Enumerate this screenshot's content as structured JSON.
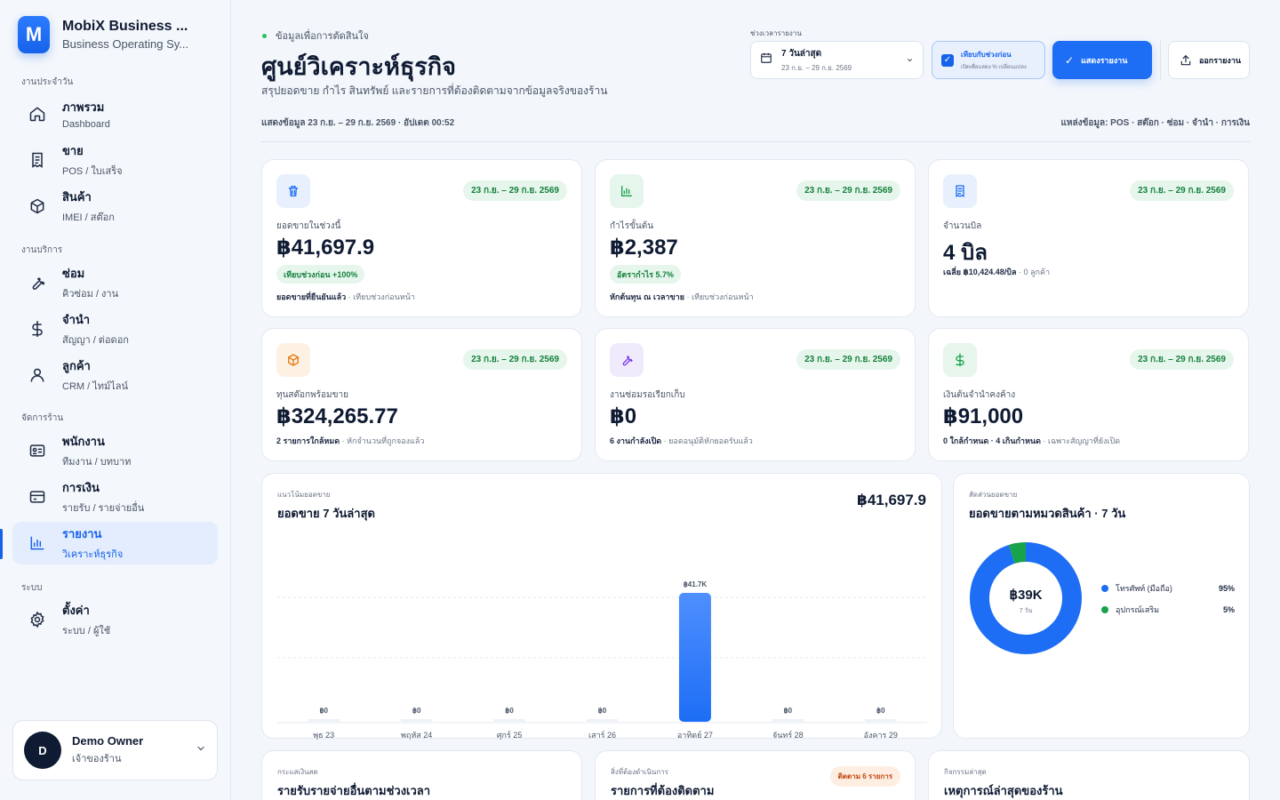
{
  "brand": {
    "logo_letter": "M",
    "title": "MobiX Business ...",
    "subtitle": "Business Operating Sy..."
  },
  "sidebar": {
    "sections": [
      "งานประจำวัน",
      "งานบริการ",
      "จัดการร้าน",
      "ระบบ"
    ],
    "items": [
      {
        "title": "ภาพรวม",
        "sub": "Dashboard",
        "icon": "home-icon"
      },
      {
        "title": "ขาย",
        "sub": "POS / ใบเสร็จ",
        "icon": "receipt-icon"
      },
      {
        "title": "สินค้า",
        "sub": "IMEI / สต๊อก",
        "icon": "box-icon"
      },
      {
        "title": "ซ่อม",
        "sub": "คิวซ่อม / งาน",
        "icon": "wrench-icon"
      },
      {
        "title": "จำนำ",
        "sub": "สัญญา / ต่อดอก",
        "icon": "dollar-icon"
      },
      {
        "title": "ลูกค้า",
        "sub": "CRM / ไทม์ไลน์",
        "icon": "user-icon"
      },
      {
        "title": "พนักงาน",
        "sub": "ทีมงาน / บทบาท",
        "icon": "id-card-icon"
      },
      {
        "title": "การเงิน",
        "sub": "รายรับ / รายจ่ายอื่น",
        "icon": "card-icon"
      },
      {
        "title": "รายงาน",
        "sub": "วิเคราะห์ธุรกิจ",
        "icon": "bar-chart-icon"
      },
      {
        "title": "ตั้งค่า",
        "sub": "ระบบ / ผู้ใช้",
        "icon": "gear-icon"
      }
    ]
  },
  "user": {
    "initial": "D",
    "name": "Demo Owner",
    "role": "เจ้าของร้าน"
  },
  "header": {
    "eyebrow": "ข้อมูลเพื่อการตัดสินใจ",
    "title": "ศูนย์วิเคราะห์ธุรกิจ",
    "description": "สรุปยอดขาย กำไร สินทรัพย์ และรายการที่ต้องติดตามจากข้อมูลจริงของร้าน",
    "range_label": "ช่วงเวลารายงาน",
    "range_main": "7 วันล่าสุด",
    "range_sub": "23 ก.ย. – 29 ก.ย. 2569",
    "compare_main": "เทียบกับช่วงก่อน",
    "compare_sub": "เปิดเพื่อแสดง % เปลี่ยนแปลง",
    "show_button": "แสดงรายงาน",
    "export_button": "ออกรายงาน",
    "info_left": "แสดงข้อมูล 23 ก.ย. – 29 ก.ย. 2569 · อัปเดต 00:52",
    "info_right": "แหล่งข้อมูล: POS · สต๊อก · ซ่อม · จำนำ · การเงิน"
  },
  "stats": [
    {
      "label": "ยอดขายในช่วงนี้",
      "value": "฿41,697.9",
      "pill": "เทียบช่วงก่อน +100%",
      "foot_bold": "ยอดขายที่ยืนยันแล้ว",
      "foot": " · เทียบช่วงก่อนหน้า",
      "date": "23 ก.ย. – 29 ก.ย. 2569",
      "icon": "trash-icon",
      "icon_color": "#1d6ef5",
      "icon_bg": "#e8f0fd"
    },
    {
      "label": "กำไรขั้นต้น",
      "value": "฿2,387",
      "pill": "อัตรากำไร 5.7%",
      "foot_bold": "หักต้นทุน ณ เวลาขาย",
      "foot": " · เทียบช่วงก่อนหน้า",
      "date": "23 ก.ย. – 29 ก.ย. 2569",
      "icon": "bar-chart-icon",
      "icon_color": "#16a34a",
      "icon_bg": "#e6f6ec"
    },
    {
      "label": "จำนวนบิล",
      "value": "4 บิล",
      "foot_bold": "เฉลี่ย ฿10,424.48/บิล",
      "foot": " · 0 ลูกค้า",
      "date": "23 ก.ย. – 29 ก.ย. 2569",
      "icon": "receipt-icon",
      "icon_color": "#1d6ef5",
      "icon_bg": "#e8f0fd"
    },
    {
      "label": "ทุนสต๊อกพร้อมขาย",
      "value": "฿324,265.77",
      "foot_bold": "2 รายการใกล้หมด",
      "foot": " · หักจำนวนที่ถูกจองแล้ว",
      "date": "23 ก.ย. – 29 ก.ย. 2569",
      "icon": "box-icon",
      "icon_color": "#ea7a12",
      "icon_bg": "#fdf1e3"
    },
    {
      "label": "งานซ่อมรอเรียกเก็บ",
      "value": "฿0",
      "foot_bold": "6 งานกำลังเปิด",
      "foot": " · ยอดอนุมัติหักยอดรับแล้ว",
      "date": "23 ก.ย. – 29 ก.ย. 2569",
      "icon": "wrench-icon",
      "icon_color": "#7c3aed",
      "icon_bg": "#f0eafd"
    },
    {
      "label": "เงินต้นจำนำคงค้าง",
      "value": "฿91,000",
      "foot_bold": "0 ใกล้กำหนด · 4 เกินกำหนด",
      "foot": " · เฉพาะสัญญาที่ยังเปิด",
      "date": "23 ก.ย. – 29 ก.ย. 2569",
      "icon": "dollar-icon",
      "icon_color": "#16a34a",
      "icon_bg": "#e6f6ec"
    }
  ],
  "trend": {
    "eyebrow": "แนวโน้มยอดขาย",
    "title": "ยอดขาย 7 วันล่าสุด",
    "total": "฿41,697.9"
  },
  "chart_data": [
    {
      "type": "bar",
      "title": "ยอดขาย 7 วันล่าสุด",
      "categories": [
        "พุธ 23",
        "พฤหัส 24",
        "ศุกร์ 25",
        "เสาร์ 26",
        "อาทิตย์ 27",
        "จันทร์ 28",
        "อังคาร 29"
      ],
      "values": [
        0,
        0,
        0,
        0,
        41697.9,
        0,
        0
      ],
      "data_labels": [
        "฿0",
        "฿0",
        "฿0",
        "฿0",
        "฿41.7K",
        "฿0",
        "฿0"
      ],
      "grid": true,
      "color": "#2b7bff"
    },
    {
      "type": "pie",
      "title": "ยอดขายตามหมวดสินค้า · 7 วัน",
      "categories": [
        "โทรศัพท์ (มือถือ)",
        "อุปกรณ์เสริม"
      ],
      "values": [
        95,
        5
      ],
      "labels": [
        "95%",
        "5%"
      ],
      "colors": [
        "#1d6ef5",
        "#16a34a"
      ],
      "center_value": "฿39K",
      "center_sub": "7 วัน",
      "legend": "right"
    }
  ],
  "share": {
    "eyebrow": "สัดส่วนยอดขาย",
    "title": "ยอดขายตามหมวดสินค้า · 7 วัน"
  },
  "bottom": [
    {
      "eyebrow": "กระแสเงินสด",
      "title": "รายรับรายจ่ายอื่นตามช่วงเวลา"
    },
    {
      "eyebrow": "สิ่งที่ต้องดำเนินการ",
      "title": "รายการที่ต้องติดตาม",
      "pill": "ติดตาม 6 รายการ"
    },
    {
      "eyebrow": "กิจกรรมล่าสุด",
      "title": "เหตุการณ์ล่าสุดของร้าน"
    }
  ]
}
